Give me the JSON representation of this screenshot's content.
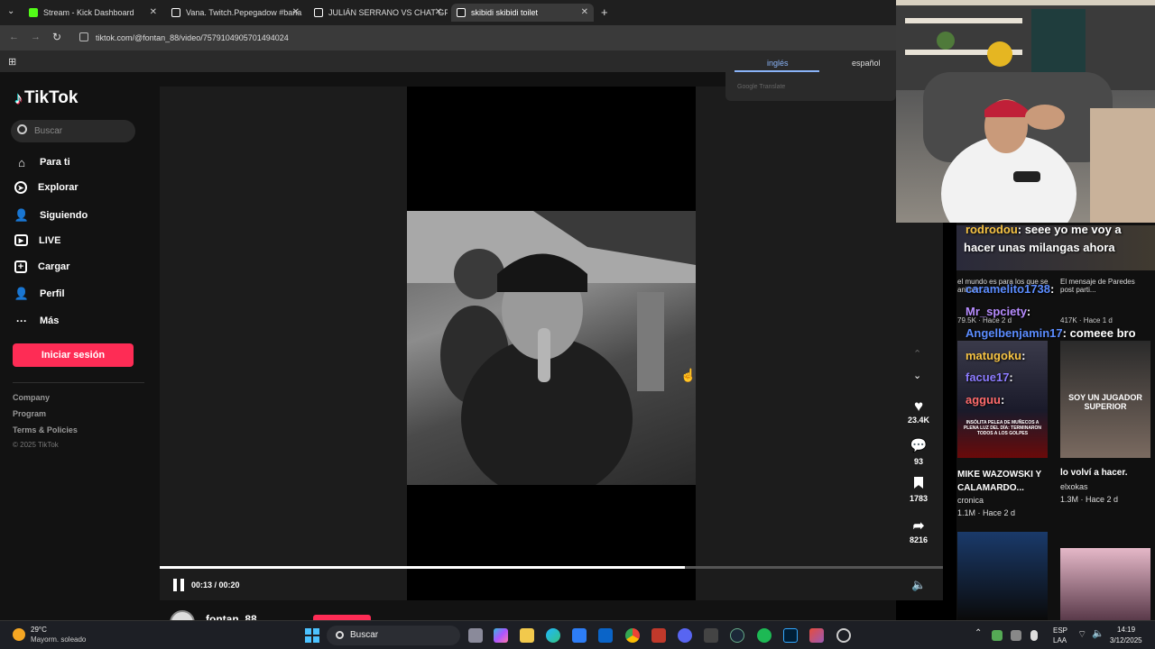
{
  "browser": {
    "tabs": [
      {
        "label": "Stream - Kick Dashboard"
      },
      {
        "label": "Vana. Twitch.Pepegadow #bana"
      },
      {
        "label": "JULIÁN SERRANO VS CHAT GPT"
      },
      {
        "label": "skibidi skibidi toilet"
      }
    ],
    "url": "tiktok.com/@fontan_88/video/7579104905701494024"
  },
  "translate": {
    "tab_english": "inglés",
    "tab_spanish": "español",
    "provider": "Google Translate"
  },
  "tiktok": {
    "logo": "TikTok",
    "search_placeholder": "Buscar",
    "nav": [
      {
        "label": "Para ti",
        "icon": "home-icon"
      },
      {
        "label": "Explorar",
        "icon": "compass-icon"
      },
      {
        "label": "Siguiendo",
        "icon": "following-icon"
      },
      {
        "label": "LIVE",
        "icon": "live-icon"
      },
      {
        "label": "Cargar",
        "icon": "upload-icon"
      },
      {
        "label": "Perfil",
        "icon": "profile-icon"
      },
      {
        "label": "Más",
        "icon": "more-icon"
      }
    ],
    "login_label": "Iniciar sesión",
    "footer": [
      "Company",
      "Program",
      "Terms & Policies",
      "© 2025 TikTok"
    ],
    "accent": "#fe2c55"
  },
  "video": {
    "time": "00:13 / 00:20",
    "progress": 0.67,
    "author": "fontan_88",
    "likes": "23.4K",
    "comments": "93",
    "saves": "1783",
    "shares": "8216"
  },
  "chat": {
    "lines": [
      {
        "user": "rodrodou",
        "text": ": seee yo me voy a",
        "color": "#f6c343"
      },
      {
        "user": "",
        "text": "hacer unas milangas ahora",
        "color": "#ffffff"
      },
      {
        "user": "caramelito1738",
        "text": ":",
        "color": "#5b8cff"
      },
      {
        "user": "Mr_spciety",
        "text": ":",
        "color": "#b78cff"
      },
      {
        "user": "Angelbenjamin17",
        "text": ": comeee bro",
        "color": "#5b8cff"
      },
      {
        "user": "matugoku",
        "text": ":",
        "color": "#f6c343"
      },
      {
        "user": "facue17",
        "text": ":",
        "color": "#8c7bff"
      },
      {
        "user": "agguu",
        "text": ":",
        "color": "#ff6b6b"
      }
    ],
    "overlay": {
      "text1": "el mundo es para los que se animan...",
      "text2": "El mensaje de Paredes post parti...",
      "stat1": "79.5K · Hace 2 d",
      "stat2": "417K · Hace 1 d",
      "card1_title": "MIKE WAZOWSKI Y CALAMARDO...",
      "card1_user": "cronica",
      "card1_stat": "1.1M · Hace 2 d",
      "card2_title": "lo volví a hacer.",
      "card2_user": "elxokas",
      "card2_stat": "1.3M · Hace 2 d",
      "thumb_caption": "SOY UN JUGADOR SUPERIOR",
      "thumb_news": "INSÓLITA PELEA DE MUÑECOS A PLENA LUZ DEL DÍA: TERMINARON TODOS A LOS GOLPES"
    }
  },
  "taskbar": {
    "weather_temp": "29°C",
    "weather_desc": "Mayorm. soleado",
    "search": "Buscar",
    "lang1": "ESP",
    "lang2": "LAA",
    "time": "14:19",
    "date": "3/12/2025"
  }
}
